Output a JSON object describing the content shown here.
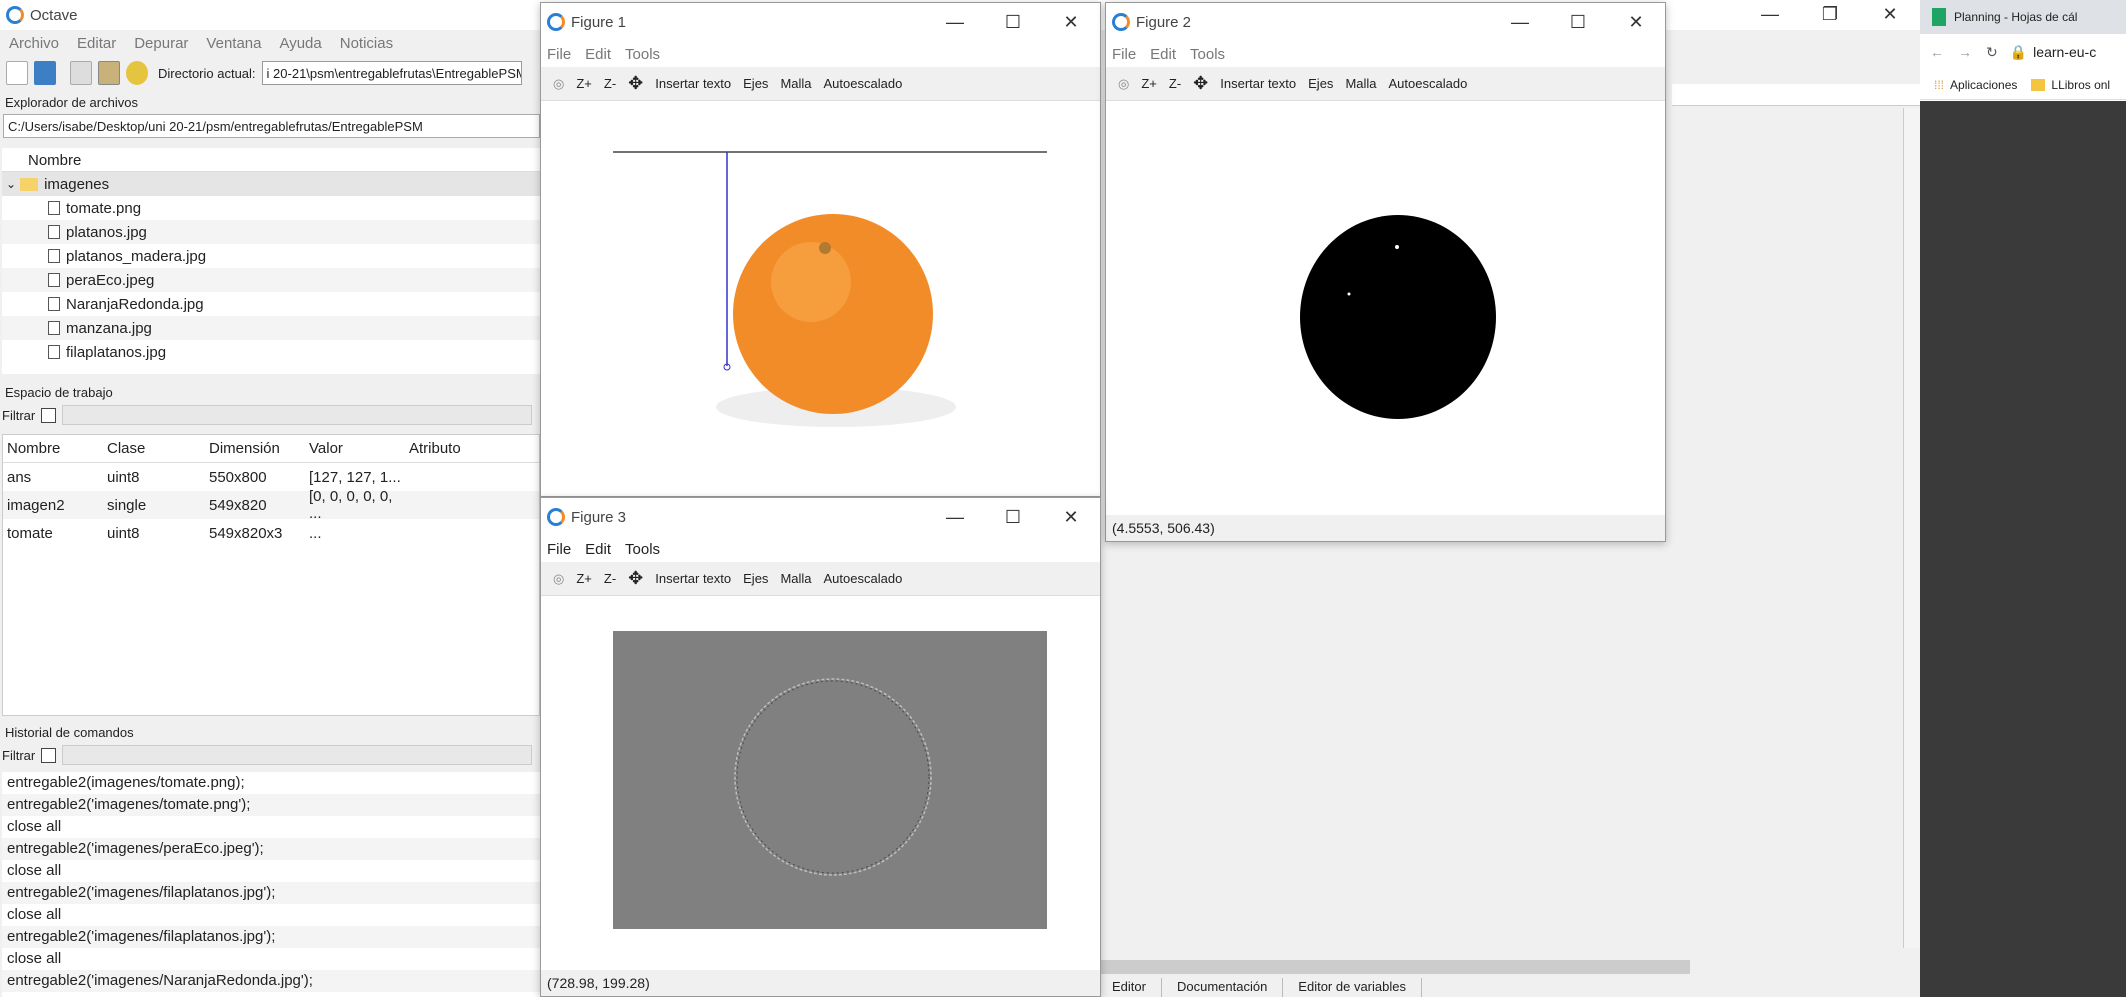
{
  "octave": {
    "title": "Octave",
    "menu": [
      "Archivo",
      "Editar",
      "Depurar",
      "Ventana",
      "Ayuda",
      "Noticias"
    ],
    "dir_label": "Directorio actual:",
    "dir_value": "i 20-21\\psm\\entregablefrutas\\EntregablePSM",
    "file_browser_title": "Explorador de archivos",
    "file_browser_path": "C:/Users/isabe/Desktop/uni 20-21/psm/entregablefrutas/EntregablePSM",
    "tree_header": "Nombre",
    "folder": "imagenes",
    "files": [
      "tomate.png",
      "platanos.jpg",
      "platanos_madera.jpg",
      "peraEco.jpeg",
      "NaranjaRedonda.jpg",
      "manzana.jpg",
      "filaplatanos.jpg"
    ],
    "workspace_title": "Espacio de trabajo",
    "filter_label": "Filtrar",
    "ws_headers": [
      "Nombre",
      "Clase",
      "Dimensión",
      "Valor",
      "Atributo"
    ],
    "ws_rows": [
      [
        "ans",
        "uint8",
        "550x800",
        "[127, 127, 1...",
        ""
      ],
      [
        "imagen2",
        "single",
        "549x820",
        "[0, 0, 0, 0, 0, ...",
        ""
      ],
      [
        "tomate",
        "uint8",
        "549x820x3",
        "...",
        ""
      ]
    ],
    "history_title": "Historial de comandos",
    "history": [
      "entregable2(imagenes/tomate.png);",
      "entregable2('imagenes/tomate.png');",
      "close all",
      "entregable2('imagenes/peraEco.jpeg');",
      "close all",
      "entregable2('imagenes/filaplatanos.jpg');",
      "close all",
      "entregable2('imagenes/filaplatanos.jpg');",
      "close all",
      "entregable2('imagenes/NaranjaRedonda.jpg');"
    ],
    "bottom_tabs": [
      "Editor",
      "Documentación",
      "Editor de variables"
    ]
  },
  "fig_menu": [
    "File",
    "Edit",
    "Tools"
  ],
  "fig_tools": [
    "Z+",
    "Z-",
    "Insertar texto",
    "Ejes",
    "Malla",
    "Autoescalado"
  ],
  "fig1": {
    "title": "Figure 1"
  },
  "fig2": {
    "title": "Figure 2",
    "status": "(4.5553, 506.43)"
  },
  "fig3": {
    "title": "Figure 3",
    "status": "(728.98, 199.28)"
  },
  "browser": {
    "tab": "Planning - Hojas de cál",
    "url": "learn-eu-c",
    "bookmark1": "Aplicaciones",
    "bookmark2": "LLibros onl"
  },
  "colors": {
    "accent": "#2a7fd4",
    "orange": "#f28c28",
    "gray_image": "#808080"
  }
}
